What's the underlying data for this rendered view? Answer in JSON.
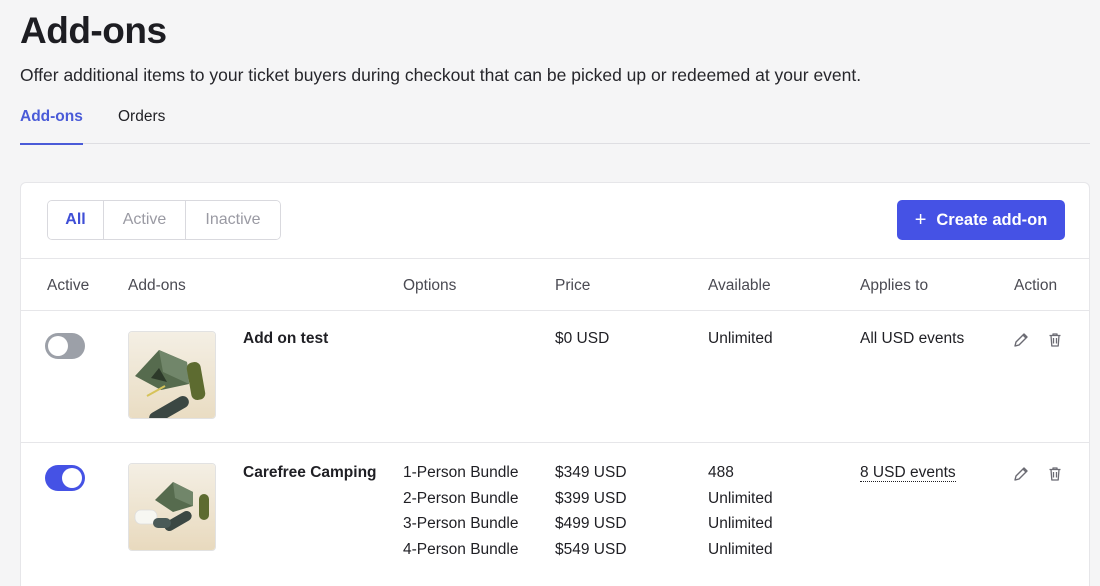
{
  "header": {
    "title": "Add-ons",
    "subtitle": "Offer additional items to your ticket buyers during checkout that can be picked up or redeemed at your event."
  },
  "tabs": [
    {
      "label": "Add-ons",
      "active": true
    },
    {
      "label": "Orders",
      "active": false
    }
  ],
  "filters": [
    {
      "label": "All",
      "active": true
    },
    {
      "label": "Active",
      "active": false
    },
    {
      "label": "Inactive",
      "active": false
    }
  ],
  "create_button": {
    "label": "Create add-on",
    "icon": "plus-icon"
  },
  "table": {
    "columns": [
      "Active",
      "Add-ons",
      "Options",
      "Price",
      "Available",
      "Applies to",
      "Action"
    ],
    "rows": [
      {
        "active": false,
        "name": "Add on test",
        "options": [],
        "prices": [
          "$0 USD"
        ],
        "available": [
          "Unlimited"
        ],
        "applies_to": "All USD events"
      },
      {
        "active": true,
        "name": "Carefree Camping",
        "options": [
          "1-Person Bundle",
          "2-Person Bundle",
          "3-Person Bundle",
          "4-Person Bundle"
        ],
        "prices": [
          "$349 USD",
          "$399 USD",
          "$499 USD",
          "$549 USD"
        ],
        "available": [
          "488",
          "Unlimited",
          "Unlimited",
          "Unlimited"
        ],
        "applies_to": "8 USD events"
      }
    ]
  },
  "colors": {
    "accent": "#4552e5",
    "tab_active": "#4a5bd8",
    "toggle_off": "#9ca0a8",
    "background": "#f5f5f6"
  }
}
